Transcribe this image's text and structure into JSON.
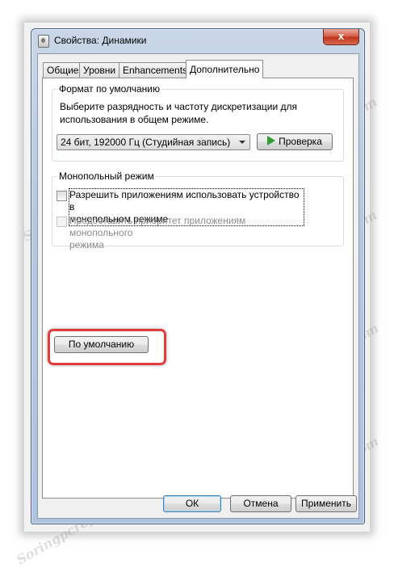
{
  "window": {
    "title": "Свойства: Динамики",
    "close_glyph": "x"
  },
  "tabs": [
    {
      "label": "Общие",
      "active": false
    },
    {
      "label": "Уровни",
      "active": false
    },
    {
      "label": "Enhancements",
      "active": false
    },
    {
      "label": "Дополнительно",
      "active": true
    }
  ],
  "default_format": {
    "legend": "Формат по умолчанию",
    "description_line1": "Выберите разрядность и частоту дискретизации для",
    "description_line2": "использования в общем режиме.",
    "selected_format": "24 бит, 192000 Гц (Студийная запись)",
    "test_button": "Проверка"
  },
  "exclusive_mode": {
    "legend": "Монопольный режим",
    "allow_exclusive": {
      "label_line1": "Разрешить приложениям использовать устройство в",
      "label_line2": "монопольном режиме",
      "checked": false
    },
    "give_priority": {
      "label_line1": "Предоставить приоритет приложениям монопольного",
      "label_line2": "режима",
      "checked": false,
      "enabled": false
    }
  },
  "restore_defaults_button": "По умолчанию",
  "footer": {
    "ok": "ОК",
    "cancel": "Отмена",
    "apply": "Применить"
  },
  "watermark_text": "Soringpcrepair.Com",
  "colors": {
    "highlight": "#e33c3c",
    "play_icon": "#2e9e2e",
    "default_button_border": "#3c7fb1"
  }
}
